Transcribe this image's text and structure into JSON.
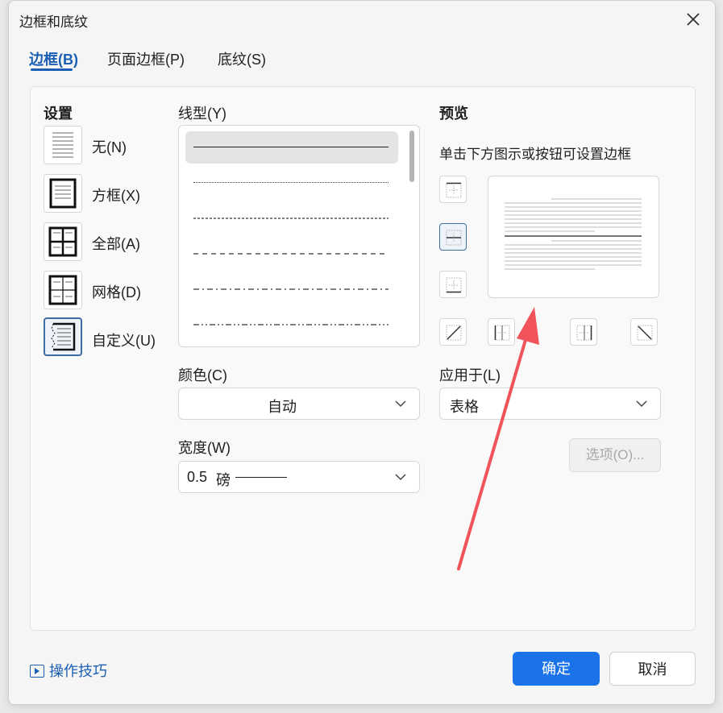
{
  "dialog": {
    "title": "边框和底纹"
  },
  "tabs": [
    {
      "label": "边框(B)",
      "active": true
    },
    {
      "label": "页面边框(P)",
      "active": false
    },
    {
      "label": "底纹(S)",
      "active": false
    }
  ],
  "setting": {
    "heading": "设置",
    "options": [
      {
        "label": "无(N)",
        "icon": "none-border-icon",
        "selected": false
      },
      {
        "label": "方框(X)",
        "icon": "box-border-icon",
        "selected": false
      },
      {
        "label": "全部(A)",
        "icon": "all-border-icon",
        "selected": false
      },
      {
        "label": "网格(D)",
        "icon": "grid-border-icon",
        "selected": false
      },
      {
        "label": "自定义(U)",
        "icon": "custom-border-icon",
        "selected": true
      }
    ]
  },
  "line_style": {
    "label": "线型(Y)",
    "options": [
      "solid",
      "dotted",
      "fine-dashed",
      "dashed",
      "dash-dot",
      "dash-dot-dot"
    ],
    "selected": "solid"
  },
  "color": {
    "label": "颜色(C)",
    "value": "自动"
  },
  "width": {
    "label": "宽度(W)",
    "value": "0.5",
    "unit": "磅"
  },
  "preview": {
    "heading": "预览",
    "hint": "单击下方图示或按钮可设置边框",
    "buttons": [
      {
        "name": "top-border-icon",
        "active": false
      },
      {
        "name": "inside-horizontal-border-icon",
        "active": true
      },
      {
        "name": "bottom-border-icon",
        "active": false
      },
      {
        "name": "diagonal-up-border-icon",
        "active": false
      },
      {
        "name": "left-border-icon",
        "active": false
      },
      {
        "name": "right-border-icon",
        "active": false
      },
      {
        "name": "diagonal-down-border-icon",
        "active": false
      }
    ]
  },
  "apply_to": {
    "label": "应用于(L)",
    "value": "表格"
  },
  "options_button": "选项(O)...",
  "tips_link": "操作技巧",
  "ok_button": "确定",
  "cancel_button": "取消",
  "colors": {
    "accent": "#1a73e8",
    "tab_active": "#1a5fb4",
    "annotation_arrow": "#f0545a"
  }
}
